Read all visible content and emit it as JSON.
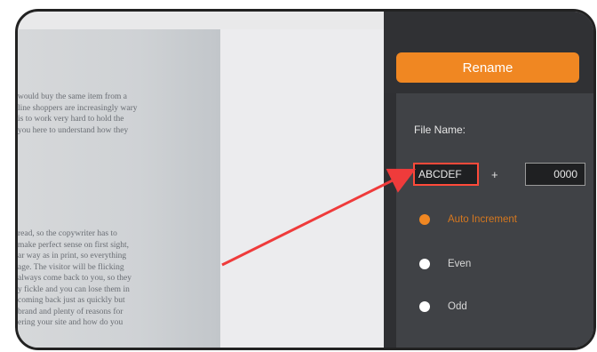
{
  "scan": {
    "paragraph1": [
      "would buy the same item from a",
      "line shoppers are increasingly wary",
      "is to work very hard to hold the",
      "you here to understand how they"
    ],
    "paragraph2": [
      "read, so the copywriter has to",
      "make perfect sense on first sight,",
      "ar way as in print, so everything",
      "age. The visitor will be flicking",
      "always come back to you, so they",
      "y fickle and you can lose them in",
      "coming back just as quickly but",
      "brand and plenty of reasons for",
      "ering your site and how do you"
    ]
  },
  "panel": {
    "rename_label": "Rename",
    "file_name_label": "File Name:",
    "name_value": "ABCDEF",
    "plus": "+",
    "number_value": "0000",
    "options": [
      {
        "label": "Auto Increment",
        "selected": true
      },
      {
        "label": "Even",
        "selected": false
      },
      {
        "label": "Odd",
        "selected": false
      }
    ]
  },
  "colors": {
    "accent": "#f08722",
    "arrow": "#ef3b3b",
    "panel_bg": "#404246"
  }
}
